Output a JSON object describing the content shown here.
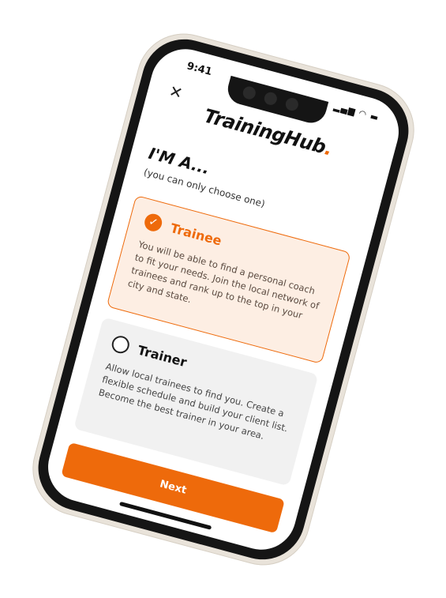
{
  "status": {
    "time": "9:41",
    "icons": "signal wifi battery"
  },
  "header": {
    "close_icon": "close-icon",
    "logo_text": "TrainingHub",
    "logo_dot": "."
  },
  "main": {
    "heading": "I'M A...",
    "subheading": "(you can only choose one)",
    "options": [
      {
        "title": "Trainee",
        "description": "You will be able to find a personal coach to fit your needs. Join the local network of trainees and rank up to the top in your city and state.",
        "selected": true,
        "icon": "check-circle-icon"
      },
      {
        "title": "Trainer",
        "description": "Allow local trainees to find you. Create a flexible schedule and build your client list. Become the best trainer in your area.",
        "selected": false,
        "icon": "radio-empty-icon"
      }
    ],
    "next_label": "Next"
  },
  "colors": {
    "accent": "#ee6a0b",
    "selected_bg": "#fdeee3",
    "unselected_bg": "#f1f1f1"
  }
}
